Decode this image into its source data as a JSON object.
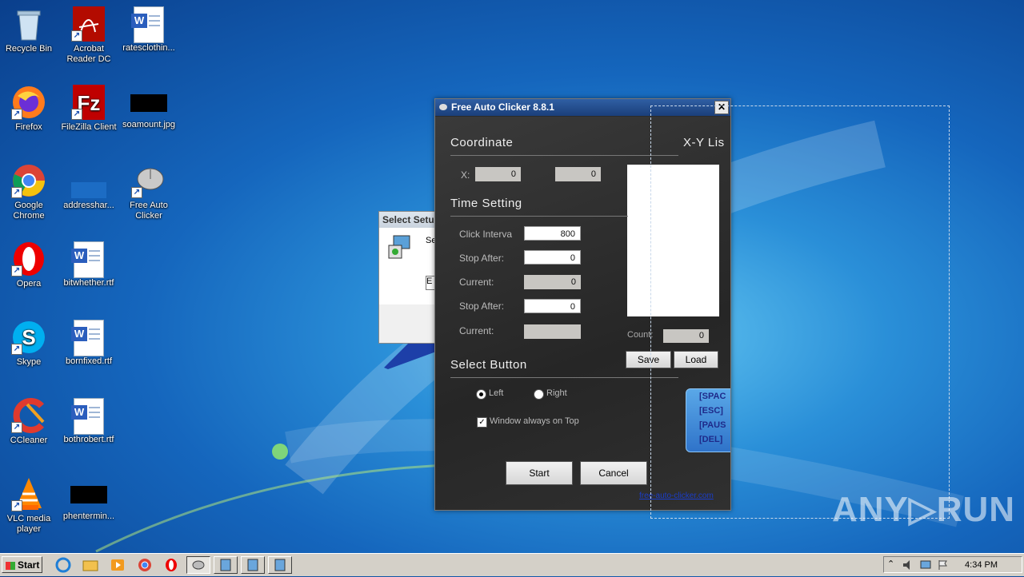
{
  "desktop": {
    "icons": [
      {
        "label": "Recycle Bin",
        "icon": "recycle-bin-icon"
      },
      {
        "label": "Acrobat Reader DC",
        "icon": "acrobat-icon"
      },
      {
        "label": "ratesclothin...",
        "icon": "word-doc-icon"
      },
      {
        "label": "Firefox",
        "icon": "firefox-icon"
      },
      {
        "label": "FileZilla Client",
        "icon": "filezilla-icon"
      },
      {
        "label": "soamount.jpg",
        "icon": "image-file-icon"
      },
      {
        "label": "Google Chrome",
        "icon": "chrome-icon"
      },
      {
        "label": "addresshar...",
        "icon": "file-icon"
      },
      {
        "label": "Free Auto Clicker",
        "icon": "mouse-icon"
      },
      {
        "label": "Opera",
        "icon": "opera-icon"
      },
      {
        "label": "bitwhether.rtf",
        "icon": "word-doc-icon"
      },
      {
        "label": "Skype",
        "icon": "skype-icon"
      },
      {
        "label": "bornfixed.rtf",
        "icon": "word-doc-icon"
      },
      {
        "label": "CCleaner",
        "icon": "ccleaner-icon"
      },
      {
        "label": "bothrobert.rtf",
        "icon": "word-doc-icon"
      },
      {
        "label": "VLC media player",
        "icon": "vlc-icon"
      },
      {
        "label": "phentermin...",
        "icon": "image-file-icon"
      }
    ]
  },
  "background_dialog": {
    "title": "Select Setu",
    "text": "Se",
    "field_value": "E"
  },
  "app": {
    "title": "Free Auto Clicker 8.8.1",
    "close": "✕",
    "coordinate": {
      "heading": "Coordinate",
      "x_label": "X:",
      "x_value": "0",
      "y_value": "0"
    },
    "xy_list": {
      "heading": "X-Y Lis",
      "count_label": "Count:",
      "count_value": "0",
      "save": "Save",
      "load": "Load"
    },
    "time_setting": {
      "heading": "Time Setting",
      "click_interval_label": "Click Interva",
      "click_interval_value": "800",
      "stop_after_1_label": "Stop After:",
      "stop_after_1_value": "0",
      "current_1_label": "Current:",
      "current_1_value": "0",
      "stop_after_2_label": "Stop After:",
      "stop_after_2_value": "0",
      "current_2_label": "Current:",
      "current_2_value": ""
    },
    "select_button": {
      "heading": "Select Button",
      "left": "Left",
      "right": "Right",
      "selected": "Left",
      "always_on_top": "Window always on Top",
      "always_on_top_checked": true,
      "check_mark": "✓"
    },
    "hotkeys": [
      "[SPAC",
      "[ESC]",
      "[PAUS",
      "[DEL]"
    ],
    "start": "Start",
    "cancel": "Cancel",
    "website": "free-auto-clicker.com"
  },
  "taskbar": {
    "start_label": "Start",
    "clock": "4:34 PM",
    "tray_chevron": "⌃"
  },
  "watermark": "ANY▷RUN"
}
